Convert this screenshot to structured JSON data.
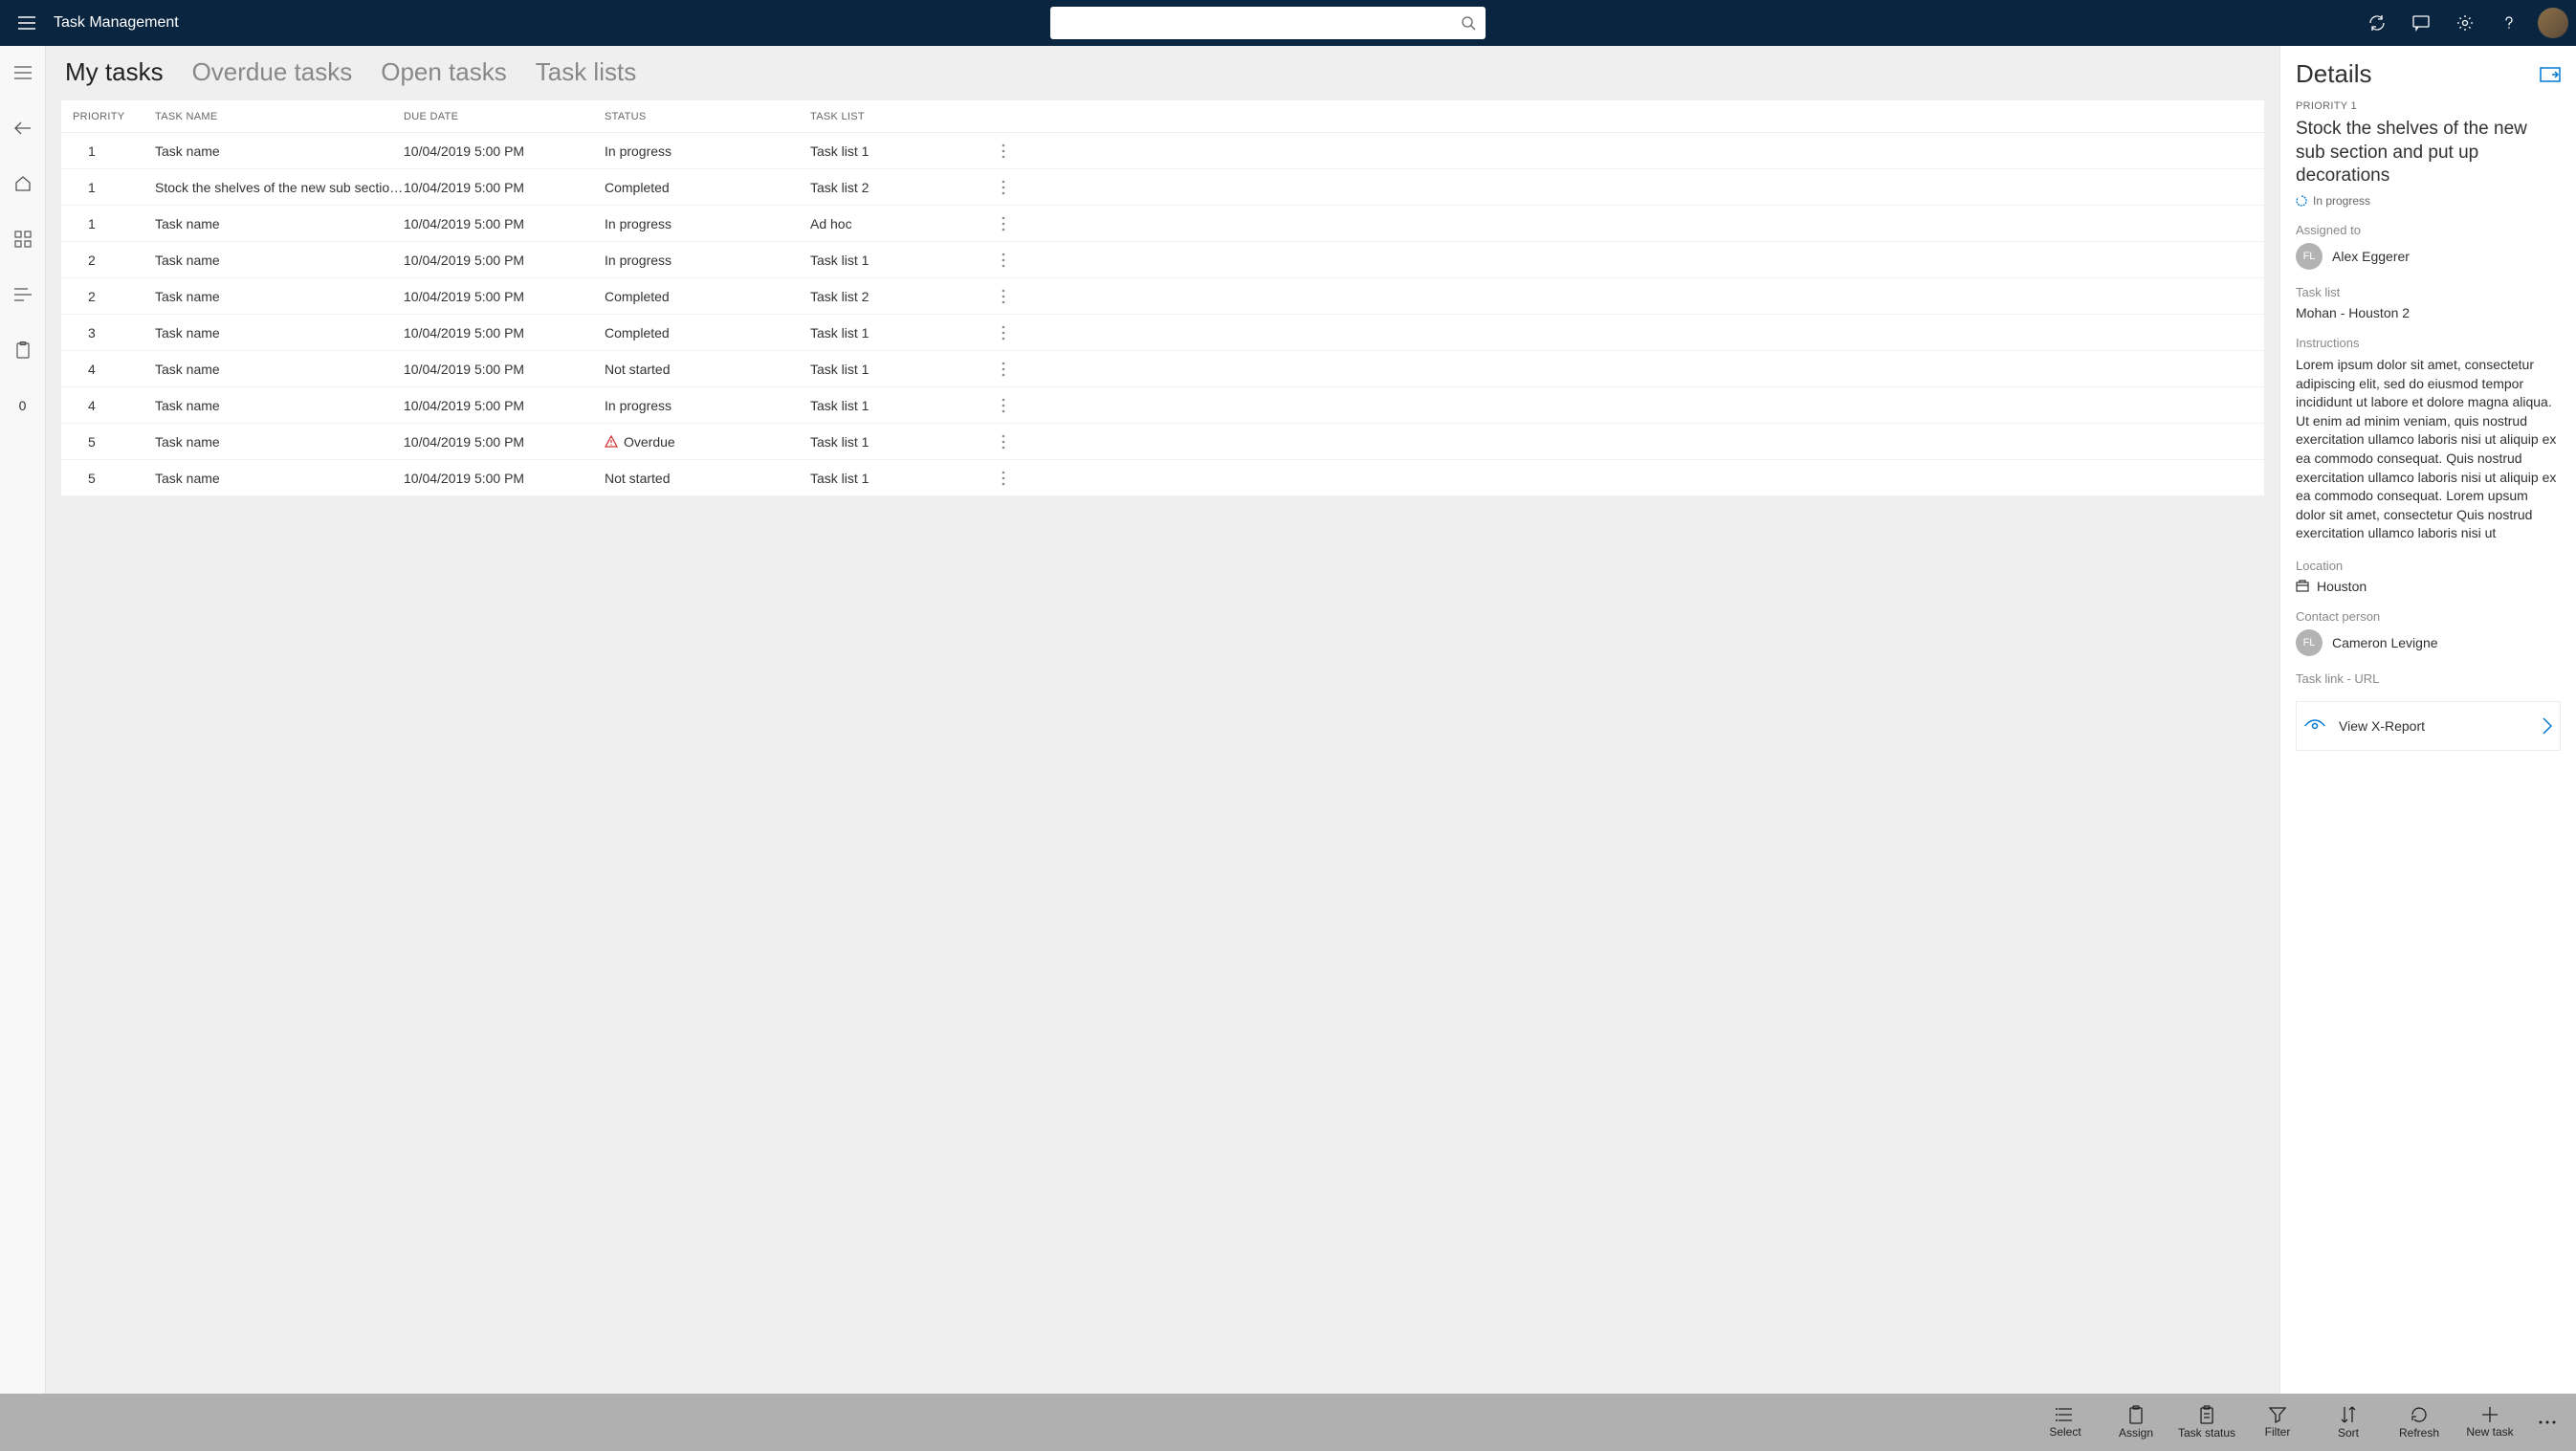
{
  "app_title": "Task Management",
  "search_placeholder": "",
  "tabs": [
    "My tasks",
    "Overdue tasks",
    "Open tasks",
    "Task lists"
  ],
  "active_tab": 0,
  "columns": [
    "PRIORITY",
    "TASK NAME",
    "DUE DATE",
    "STATUS",
    "TASK LIST"
  ],
  "rows": [
    {
      "priority": "1",
      "name": "Task name",
      "due": "10/04/2019 5:00 PM",
      "status": "In progress",
      "list": "Task list 1",
      "overdue": false
    },
    {
      "priority": "1",
      "name": "Stock the shelves of the new sub section…",
      "due": "10/04/2019 5:00 PM",
      "status": "Completed",
      "list": "Task list 2",
      "overdue": false
    },
    {
      "priority": "1",
      "name": "Task name",
      "due": "10/04/2019 5:00 PM",
      "status": "In progress",
      "list": "Ad hoc",
      "overdue": false
    },
    {
      "priority": "2",
      "name": "Task name",
      "due": "10/04/2019 5:00 PM",
      "status": "In progress",
      "list": "Task list 1",
      "overdue": false
    },
    {
      "priority": "2",
      "name": "Task name",
      "due": "10/04/2019 5:00 PM",
      "status": "Completed",
      "list": "Task list 2",
      "overdue": false
    },
    {
      "priority": "3",
      "name": "Task name",
      "due": "10/04/2019 5:00 PM",
      "status": "Completed",
      "list": "Task list 1",
      "overdue": false
    },
    {
      "priority": "4",
      "name": "Task name",
      "due": "10/04/2019 5:00 PM",
      "status": "Not started",
      "list": "Task list 1",
      "overdue": false
    },
    {
      "priority": "4",
      "name": "Task name",
      "due": "10/04/2019 5:00 PM",
      "status": "In progress",
      "list": "Task list 1",
      "overdue": false
    },
    {
      "priority": "5",
      "name": "Task name",
      "due": "10/04/2019 5:00 PM",
      "status": "Overdue",
      "list": "Task list 1",
      "overdue": true
    },
    {
      "priority": "5",
      "name": "Task name",
      "due": "10/04/2019 5:00 PM",
      "status": "Not started",
      "list": "Task list 1",
      "overdue": false
    }
  ],
  "leftrail_badge": "0",
  "details": {
    "heading": "Details",
    "priority_label": "PRIORITY 1",
    "title": "Stock the shelves of the new sub section and put up decorations",
    "status": "In progress",
    "assigned_label": "Assigned to",
    "assigned_initials": "FL",
    "assigned_name": "Alex Eggerer",
    "tasklist_label": "Task list",
    "tasklist_value": "Mohan - Houston 2",
    "instructions_label": "Instructions",
    "instructions_text": "Lorem ipsum dolor sit amet, consectetur adipiscing elit, sed do eiusmod tempor incididunt ut labore et dolore magna aliqua. Ut enim ad minim veniam, quis nostrud exercitation ullamco laboris nisi ut aliquip ex ea commodo consequat. Quis nostrud exercitation ullamco laboris nisi ut aliquip ex ea commodo consequat. Lorem upsum dolor sit amet, consectetur Quis nostrud exercitation ullamco laboris nisi ut",
    "location_label": "Location",
    "location_value": "Houston",
    "contact_label": "Contact person",
    "contact_initials": "FL",
    "contact_name": "Cameron Levigne",
    "link_label": "Task link - URL",
    "link_action": "View X-Report"
  },
  "bottom_actions": [
    {
      "id": "select",
      "label": "Select"
    },
    {
      "id": "assign",
      "label": "Assign"
    },
    {
      "id": "task-status",
      "label": "Task status"
    },
    {
      "id": "filter",
      "label": "Filter"
    },
    {
      "id": "sort",
      "label": "Sort"
    },
    {
      "id": "refresh",
      "label": "Refresh"
    },
    {
      "id": "new-task",
      "label": "New task"
    }
  ]
}
